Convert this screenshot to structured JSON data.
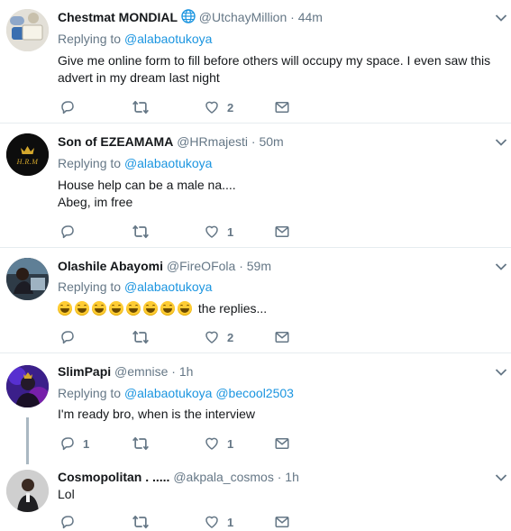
{
  "tweets": [
    {
      "name": "Chestmat MONDIAL",
      "handle": "@UtchayMillion",
      "dot": "·",
      "time": "44m",
      "replying_prefix": "Replying to",
      "mentions": [
        "@alabaotukoya"
      ],
      "lines": [
        "Give me online form to fill before others will occupy my space. I even saw this",
        "advert in my dream last night"
      ],
      "replies": "",
      "likes": "2",
      "avatar_icon": "avatar-photo"
    },
    {
      "name": "Son of EZEAMAMA",
      "handle": "@HRmajesti",
      "dot": "·",
      "time": "50m",
      "replying_prefix": "Replying to",
      "mentions": [
        "@alabaotukoya"
      ],
      "lines": [
        "House help can be a male na....",
        "Abeg, im free"
      ],
      "replies": "",
      "likes": "1",
      "avatar_text": "H.R.M"
    },
    {
      "name": "Olashile Abayomi",
      "handle": "@FireOFola",
      "dot": "·",
      "time": "59m",
      "replying_prefix": "Replying to",
      "mentions": [
        "@alabaotukoya"
      ],
      "text_after_emojis": "the replies...",
      "emoji_count": 8,
      "replies": "",
      "likes": "2"
    },
    {
      "name": "SlimPapi",
      "handle": "@emnise",
      "dot": "·",
      "time": "1h",
      "replying_prefix": "Replying to",
      "mentions": [
        "@alabaotukoya",
        "@becool2503"
      ],
      "lines": [
        "I'm ready bro, when is the interview"
      ],
      "replies": "1",
      "likes": "1"
    },
    {
      "name": "Cosmopolitan . .....",
      "handle": "@akpala_cosmos",
      "dot": "·",
      "time": "1h",
      "lines": [
        "Lol"
      ],
      "replies": "",
      "likes": "1"
    }
  ],
  "colors": {
    "link": "#1b95e0",
    "muted": "#657786",
    "separator": "#e6ecf0",
    "thread_line": "#aab8c2"
  },
  "icons": {
    "verified_globe": "globe-icon",
    "reply": "reply-icon",
    "retweet": "retweet-icon",
    "like": "heart-icon",
    "dm": "envelope-icon",
    "more": "chevron-down-icon"
  }
}
